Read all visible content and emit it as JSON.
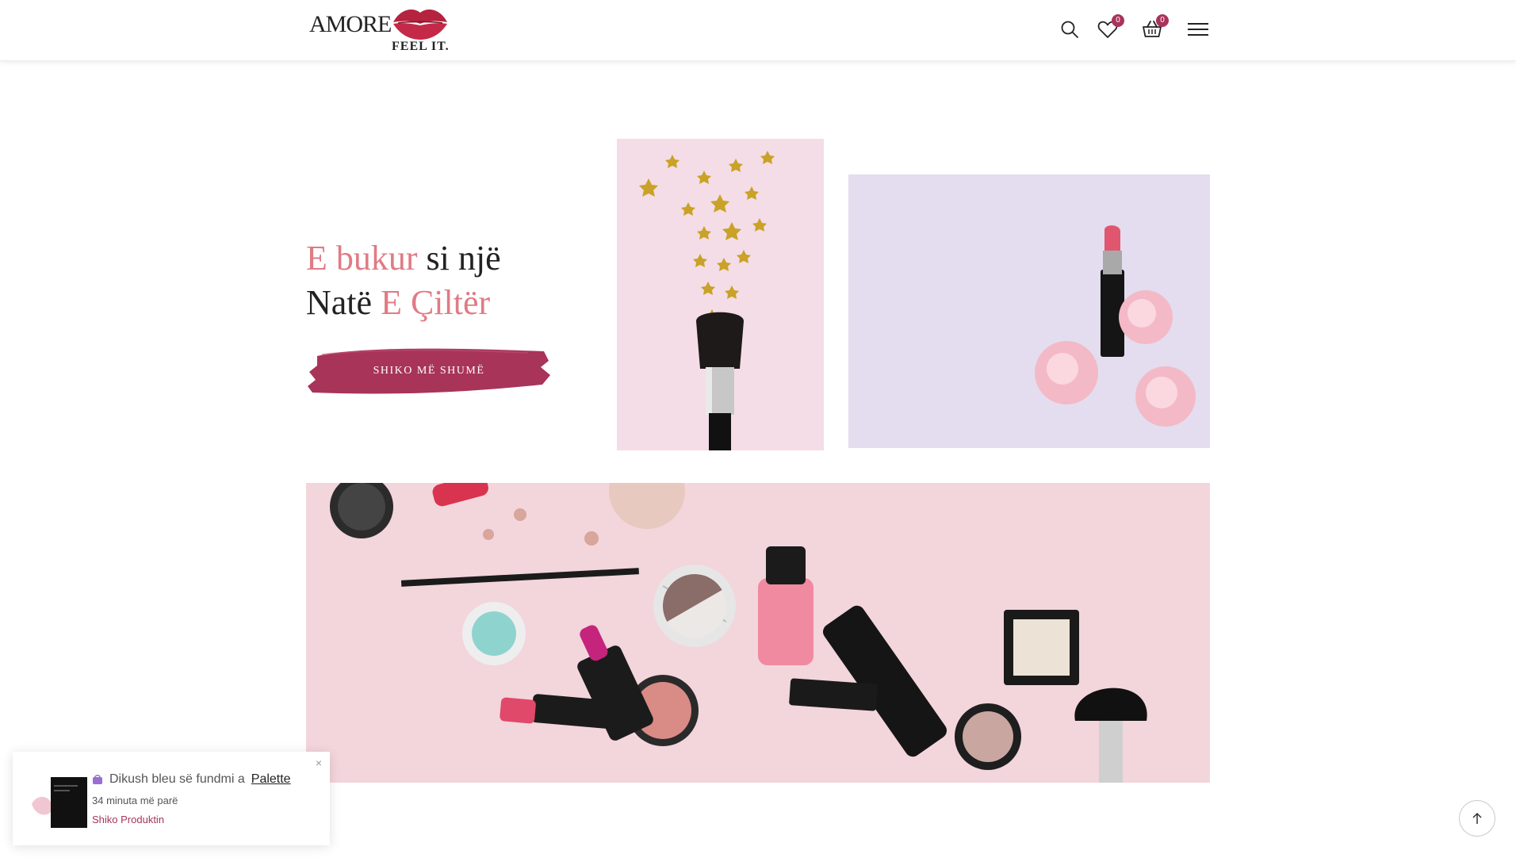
{
  "header": {
    "logo_text": "AMORE",
    "logo_tagline": "FEEL IT.",
    "wishlist_count": "0",
    "cart_count": "0",
    "icons": [
      "search-icon",
      "heart-icon",
      "basket-icon",
      "menu-icon"
    ]
  },
  "hero": {
    "title_part1": "E bukur",
    "title_part2": " si një",
    "title_part3": "Natë",
    "title_part4": " E Çiltër",
    "cta_label": "SHIKO MË SHUMË"
  },
  "notification": {
    "message": "Dikush bleu së fundmi a",
    "product": "Palette",
    "time": "34 minuta më parë",
    "link": "Shiko Produktin",
    "close": "×"
  },
  "colors": {
    "accent": "#e07b85",
    "brand": "#a8345a"
  }
}
